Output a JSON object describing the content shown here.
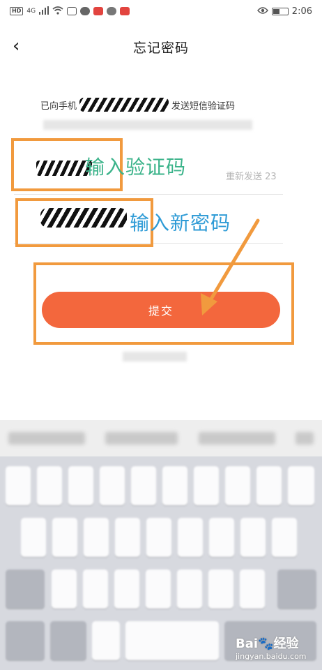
{
  "status_bar": {
    "network_badge": "HD",
    "network_gen": "4G",
    "time": "2:06"
  },
  "header": {
    "back_glyph": "‹",
    "title": "忘记密码"
  },
  "form": {
    "sent_prefix": "已向手机",
    "sent_suffix": "发送短信验证码",
    "resend_label": "重新发送 23",
    "submit_label": "提交"
  },
  "annotations": {
    "code_label": "输入验证码",
    "password_label": "输入新密码"
  },
  "watermark": {
    "brand": "Bai🐾经验",
    "url": "jingyan.baidu.com"
  },
  "icons": {
    "back": "chevron-left-icon",
    "wifi": "wifi-icon",
    "eye": "eye-icon",
    "battery": "battery-icon"
  },
  "colors": {
    "accent": "#f3673d",
    "annotation_border": "#f19a3e",
    "annotation_text_blue": "#2e9bd6",
    "annotation_text_green": "#3bb38a"
  }
}
